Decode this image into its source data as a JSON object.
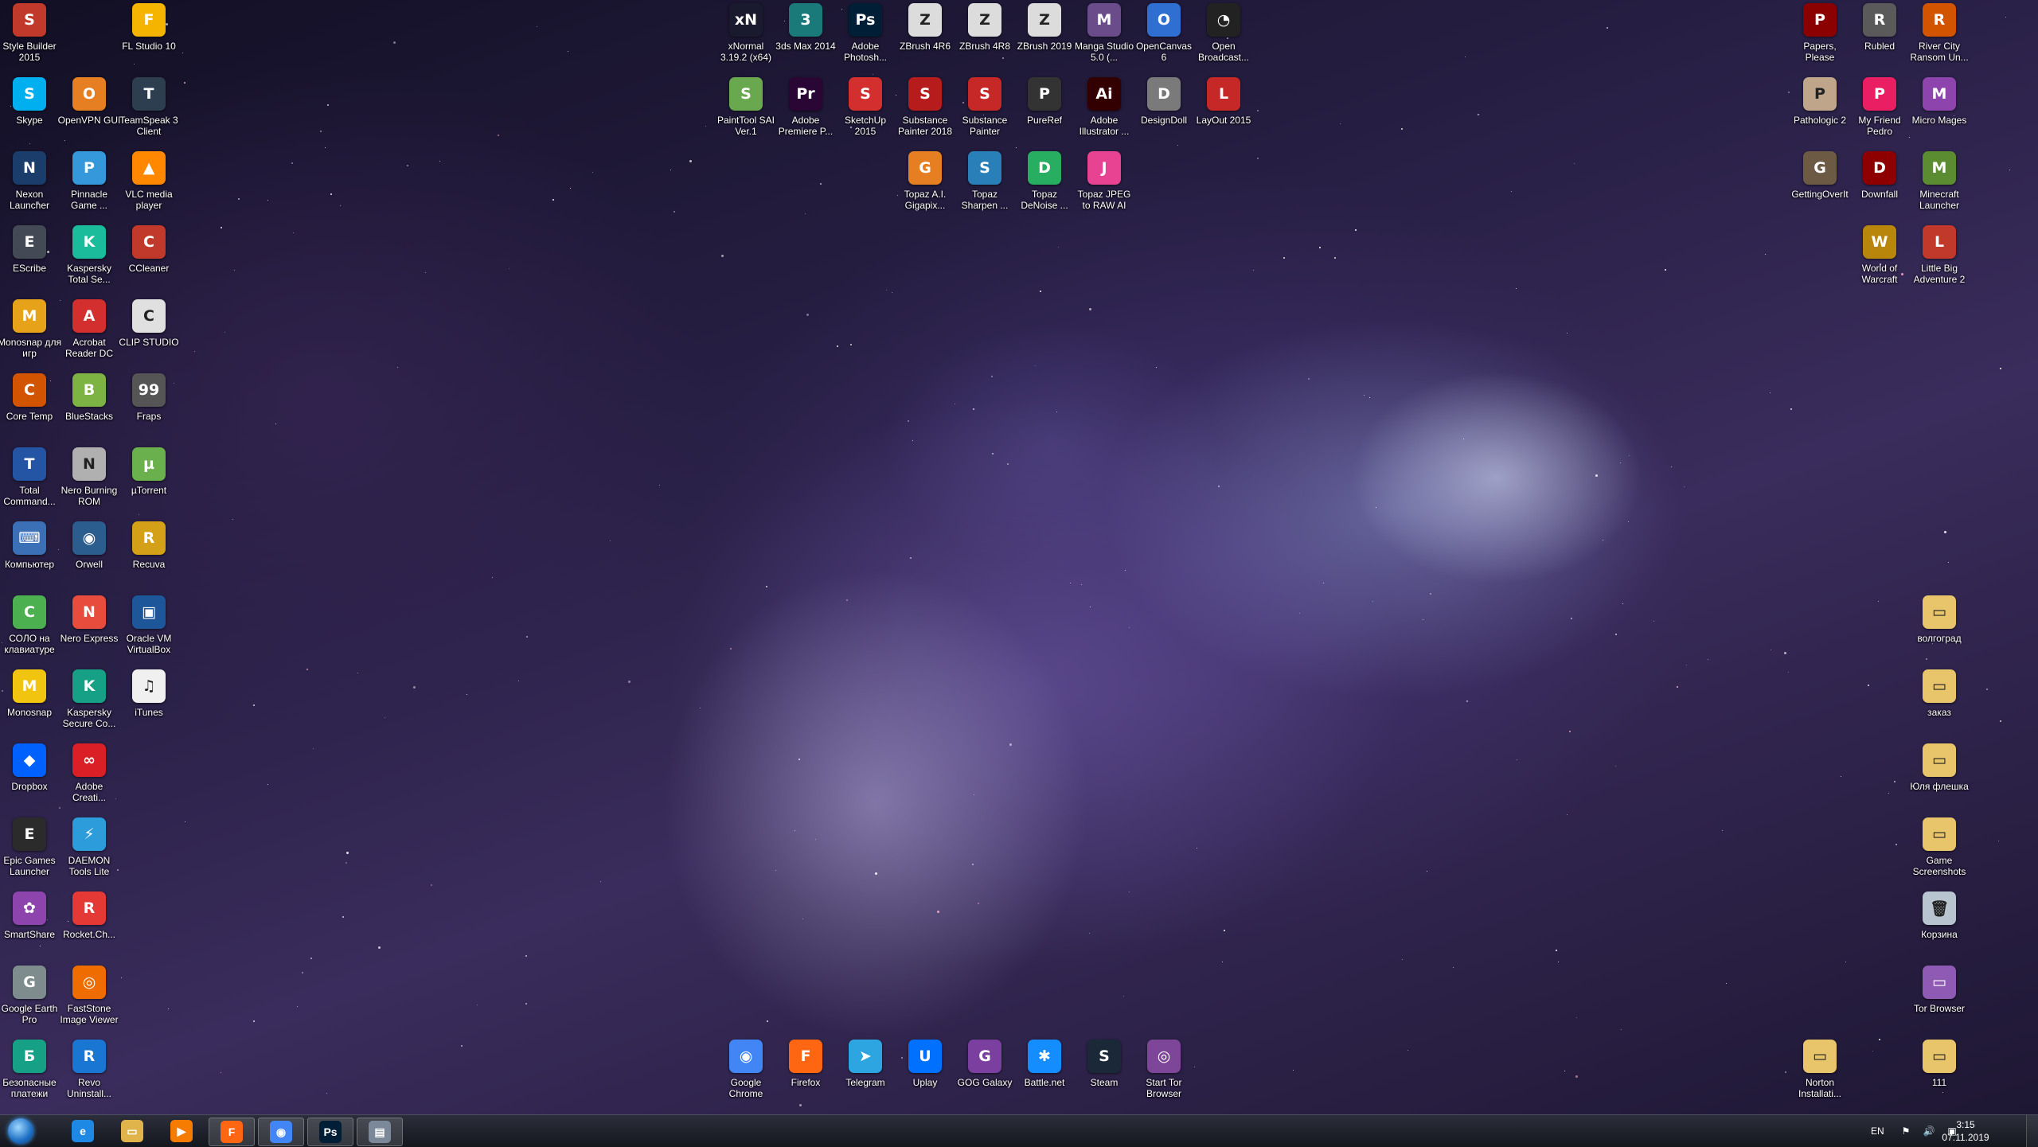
{
  "desktop": {
    "col1": [
      {
        "label": "Style Builder 2015",
        "icon": "style-builder-icon",
        "color": "#c0392b",
        "glyph": "S"
      },
      {
        "label": "Skype",
        "icon": "skype-icon",
        "color": "#00aff0",
        "glyph": "S"
      },
      {
        "label": "Nexon Launcher",
        "icon": "nexon-icon",
        "color": "#1b3d6b",
        "glyph": "N"
      },
      {
        "label": "EScribe",
        "icon": "escribe-icon",
        "color": "#444a55",
        "glyph": "E"
      },
      {
        "label": "Monosnap для игр",
        "icon": "monosnap-games-icon",
        "color": "#e6a31a",
        "glyph": "M"
      },
      {
        "label": "Core Temp",
        "icon": "core-temp-icon",
        "color": "#d35400",
        "glyph": "C"
      },
      {
        "label": "Total Command...",
        "icon": "total-commander-icon",
        "color": "#2455a4",
        "glyph": "T"
      },
      {
        "label": "Компьютер",
        "icon": "computer-icon",
        "color": "#3b6fb6",
        "glyph": "⌨"
      },
      {
        "label": "СОЛО на клавиатуре",
        "icon": "solo-keyboard-icon",
        "color": "#4caf50",
        "glyph": "С"
      },
      {
        "label": "Monosnap",
        "icon": "monosnap-icon",
        "color": "#f1c40f",
        "glyph": "M"
      },
      {
        "label": "Dropbox",
        "icon": "dropbox-icon",
        "color": "#0061fe",
        "glyph": "◆"
      },
      {
        "label": "Epic Games Launcher",
        "icon": "epic-games-icon",
        "color": "#2b2b2b",
        "glyph": "E"
      },
      {
        "label": "SmartShare",
        "icon": "smartshare-icon",
        "color": "#8e44ad",
        "glyph": "✿"
      },
      {
        "label": "Google Earth Pro",
        "icon": "google-earth-icon",
        "color": "#7f8c8d",
        "glyph": "G"
      },
      {
        "label": "Безопасные платежи",
        "icon": "safe-payments-icon",
        "color": "#16a085",
        "glyph": "Б"
      }
    ],
    "col2": [
      {
        "label": "OpenVPN GUI",
        "icon": "openvpn-icon",
        "color": "#e67e22",
        "glyph": "O"
      },
      {
        "label": "Pinnacle Game ...",
        "icon": "pinnacle-icon",
        "color": "#3498db",
        "glyph": "P"
      },
      {
        "label": "Kaspersky Total Se...",
        "icon": "kaspersky-total-icon",
        "color": "#1abc9c",
        "glyph": "K"
      },
      {
        "label": "Acrobat Reader DC",
        "icon": "acrobat-icon",
        "color": "#d32f2f",
        "glyph": "A"
      },
      {
        "label": "BlueStacks",
        "icon": "bluestacks-icon",
        "color": "#7cb342",
        "glyph": "B"
      },
      {
        "label": "Nero Burning ROM",
        "icon": "nero-burning-icon",
        "color": "#b0b0b0",
        "glyph": "N"
      },
      {
        "label": "Orwell",
        "icon": "orwell-icon",
        "color": "#2c5d8f",
        "glyph": "◉"
      },
      {
        "label": "Nero Express",
        "icon": "nero-express-icon",
        "color": "#e74c3c",
        "glyph": "N"
      },
      {
        "label": "Kaspersky Secure Co...",
        "icon": "kaspersky-secure-icon",
        "color": "#16a085",
        "glyph": "K"
      },
      {
        "label": "Adobe Creati...",
        "icon": "adobe-creative-icon",
        "color": "#da1f26",
        "glyph": "∞"
      },
      {
        "label": "DAEMON Tools Lite",
        "icon": "daemon-tools-icon",
        "color": "#2d9cdb",
        "glyph": "⚡"
      },
      {
        "label": "Rocket.Ch...",
        "icon": "rocket-chat-icon",
        "color": "#e53935",
        "glyph": "R"
      },
      {
        "label": "FastStone Image Viewer",
        "icon": "faststone-icon",
        "color": "#ef6c00",
        "glyph": "◎"
      },
      {
        "label": "Revo Uninstall...",
        "icon": "revo-uninstaller-icon",
        "color": "#1976d2",
        "glyph": "R"
      }
    ],
    "col3": [
      {
        "label": "FL Studio 10",
        "icon": "fl-studio-icon",
        "color": "#f4b400",
        "glyph": "F"
      },
      {
        "label": "TeamSpeak 3 Client",
        "icon": "teamspeak-icon",
        "color": "#2c3e50",
        "glyph": "T"
      },
      {
        "label": "VLC media player",
        "icon": "vlc-icon",
        "color": "#ff8800",
        "glyph": "▲"
      },
      {
        "label": "CCleaner",
        "icon": "ccleaner-icon",
        "color": "#c0392b",
        "glyph": "C"
      },
      {
        "label": "CLIP STUDIO",
        "icon": "clip-studio-icon",
        "color": "#e0e0e0",
        "glyph": "C"
      },
      {
        "label": "Fraps",
        "icon": "fraps-icon",
        "color": "#555555",
        "glyph": "99"
      },
      {
        "label": "µTorrent",
        "icon": "utorrent-icon",
        "color": "#6ab04c",
        "glyph": "µ"
      },
      {
        "label": "Recuva",
        "icon": "recuva-icon",
        "color": "#d4a017",
        "glyph": "R"
      },
      {
        "label": "Oracle VM VirtualBox",
        "icon": "virtualbox-icon",
        "color": "#1e5799",
        "glyph": "▣"
      },
      {
        "label": "iTunes",
        "icon": "itunes-icon",
        "color": "#f0f0f0",
        "glyph": "♫"
      }
    ],
    "top_row1": [
      {
        "label": "xNormal 3.19.2 (x64)",
        "icon": "xnormal-icon",
        "color": "#1a1a2e",
        "glyph": "xN"
      },
      {
        "label": "3ds Max 2014",
        "icon": "3dsmax-icon",
        "color": "#1a7a7a",
        "glyph": "3"
      },
      {
        "label": "Adobe Photosh...",
        "icon": "photoshop-icon",
        "color": "#001e36",
        "glyph": "Ps"
      },
      {
        "label": "ZBrush 4R6",
        "icon": "zbrush-4r6-icon",
        "color": "#dcdcdc",
        "glyph": "Z"
      },
      {
        "label": "ZBrush 4R8",
        "icon": "zbrush-4r8-icon",
        "color": "#dcdcdc",
        "glyph": "Z"
      },
      {
        "label": "ZBrush 2019",
        "icon": "zbrush-2019-icon",
        "color": "#dcdcdc",
        "glyph": "Z"
      },
      {
        "label": "Manga Studio 5.0 (...",
        "icon": "manga-studio-icon",
        "color": "#6b4c8a",
        "glyph": "M"
      },
      {
        "label": "OpenCanvas 6",
        "icon": "opencanvas-icon",
        "color": "#2f6fd1",
        "glyph": "O"
      },
      {
        "label": "Open Broadcast...",
        "icon": "obs-icon",
        "color": "#222222",
        "glyph": "◔"
      }
    ],
    "top_row2": [
      {
        "label": "PaintTool SAI Ver.1",
        "icon": "painttool-sai-icon",
        "color": "#6aa84f",
        "glyph": "S"
      },
      {
        "label": "Adobe Premiere P...",
        "icon": "premiere-icon",
        "color": "#2a0634",
        "glyph": "Pr"
      },
      {
        "label": "SketchUp 2015",
        "icon": "sketchup-icon",
        "color": "#d32f2f",
        "glyph": "S"
      },
      {
        "label": "Substance Painter 2018",
        "icon": "substance-2018-icon",
        "color": "#b71c1c",
        "glyph": "S"
      },
      {
        "label": "Substance Painter",
        "icon": "substance-icon",
        "color": "#c62828",
        "glyph": "S"
      },
      {
        "label": "PureRef",
        "icon": "pureref-icon",
        "color": "#333333",
        "glyph": "P"
      },
      {
        "label": "Adobe Illustrator ...",
        "icon": "illustrator-icon",
        "color": "#330000",
        "glyph": "Ai"
      },
      {
        "label": "DesignDoll",
        "icon": "designdoll-icon",
        "color": "#7a7a7a",
        "glyph": "D"
      },
      {
        "label": "LayOut 2015",
        "icon": "layout-icon",
        "color": "#c62828",
        "glyph": "L"
      }
    ],
    "top_row3": [
      {
        "label": "Topaz A.I. Gigapix...",
        "icon": "topaz-gigapixel-icon",
        "color": "#e67e22",
        "glyph": "G"
      },
      {
        "label": "Topaz Sharpen ...",
        "icon": "topaz-sharpen-icon",
        "color": "#2980b9",
        "glyph": "S"
      },
      {
        "label": "Topaz DeNoise ...",
        "icon": "topaz-denoise-icon",
        "color": "#27ae60",
        "glyph": "D"
      },
      {
        "label": "Topaz JPEG to RAW AI",
        "icon": "topaz-jpeg-icon",
        "color": "#e84393",
        "glyph": "J"
      }
    ],
    "bottom_row": [
      {
        "label": "Google Chrome",
        "icon": "chrome-icon",
        "color": "#4285f4",
        "glyph": "◉"
      },
      {
        "label": "Firefox",
        "icon": "firefox-icon",
        "color": "#ff6611",
        "glyph": "F"
      },
      {
        "label": "Telegram",
        "icon": "telegram-icon",
        "color": "#2ca5e0",
        "glyph": "➤"
      },
      {
        "label": "Uplay",
        "icon": "uplay-icon",
        "color": "#0070ff",
        "glyph": "U"
      },
      {
        "label": "GOG Galaxy",
        "icon": "gog-galaxy-icon",
        "color": "#7b3fa0",
        "glyph": "G"
      },
      {
        "label": "Battle.net",
        "icon": "battlenet-icon",
        "color": "#148eff",
        "glyph": "✱"
      },
      {
        "label": "Steam",
        "icon": "steam-icon",
        "color": "#1b2838",
        "glyph": "S"
      },
      {
        "label": "Start Tor Browser",
        "icon": "tor-browser-icon",
        "color": "#7d4698",
        "glyph": "◎"
      }
    ],
    "right_top1": [
      {
        "label": "Papers, Please",
        "icon": "papers-please-icon",
        "color": "#8b0000",
        "glyph": "P"
      },
      {
        "label": "Pathologic 2",
        "icon": "pathologic-icon",
        "color": "#bfa58a",
        "glyph": "P"
      },
      {
        "label": "GettingOverIt",
        "icon": "getting-over-it-icon",
        "color": "#6d5a45",
        "glyph": "G"
      }
    ],
    "right_top2": [
      {
        "label": "Rubled",
        "icon": "rubled-icon",
        "color": "#5a5a5a",
        "glyph": "R"
      },
      {
        "label": "My Friend Pedro",
        "icon": "my-friend-pedro-icon",
        "color": "#e91e63",
        "glyph": "P"
      },
      {
        "label": "Downfall",
        "icon": "downfall-icon",
        "color": "#8e0000",
        "glyph": "D"
      },
      {
        "label": "World of Warcraft",
        "icon": "wow-icon",
        "color": "#b8860b",
        "glyph": "W"
      }
    ],
    "right_top3": [
      {
        "label": "River City Ransom Un...",
        "icon": "river-city-icon",
        "color": "#d35400",
        "glyph": "R"
      },
      {
        "label": "Micro Mages",
        "icon": "micro-mages-icon",
        "color": "#8e44ad",
        "glyph": "M"
      },
      {
        "label": "Minecraft Launcher",
        "icon": "minecraft-icon",
        "color": "#5b8c32",
        "glyph": "M"
      },
      {
        "label": "Little Big Adventure 2",
        "icon": "lba2-icon",
        "color": "#c0392b",
        "glyph": "L"
      }
    ],
    "right_col_folders": [
      {
        "label": "волгоград",
        "icon": "folder-icon",
        "color": "#e8c56b",
        "glyph": "▭"
      },
      {
        "label": "заказ",
        "icon": "folder-icon",
        "color": "#e8c56b",
        "glyph": "▭"
      },
      {
        "label": "Юля флешка",
        "icon": "folder-icon",
        "color": "#e8c56b",
        "glyph": "▭"
      },
      {
        "label": "Game Screenshots",
        "icon": "folder-icon",
        "color": "#e8c56b",
        "glyph": "▭"
      },
      {
        "label": "Корзина",
        "icon": "recycle-bin-icon",
        "color": "#b8c4cf",
        "glyph": "🗑"
      },
      {
        "label": "Tor Browser",
        "icon": "folder-icon",
        "color": "#8e5ab3",
        "glyph": "▭"
      },
      {
        "label": "111",
        "icon": "folder-icon",
        "color": "#e8c56b",
        "glyph": "▭"
      }
    ],
    "norton": {
      "label": "Norton Installati...",
      "icon": "norton-folder-icon",
      "color": "#e8c56b",
      "glyph": "▭"
    }
  },
  "taskbar": {
    "start_label": "Start",
    "pinned": [
      {
        "name": "internet-explorer",
        "icon": "ie-icon",
        "color": "#1e88e5",
        "glyph": "e",
        "active": false
      },
      {
        "name": "explorer",
        "icon": "folder-icon",
        "color": "#e0b44a",
        "glyph": "▭",
        "active": false
      },
      {
        "name": "media-player",
        "icon": "media-player-icon",
        "color": "#f57c00",
        "glyph": "▶",
        "active": false
      },
      {
        "name": "firefox",
        "icon": "firefox-icon",
        "color": "#ff6611",
        "glyph": "F",
        "active": true
      },
      {
        "name": "chrome",
        "icon": "chrome-icon",
        "color": "#4285f4",
        "glyph": "◉",
        "active": true
      },
      {
        "name": "photoshop",
        "icon": "photoshop-icon",
        "color": "#001e36",
        "glyph": "Ps",
        "active": true
      },
      {
        "name": "document",
        "icon": "document-icon",
        "color": "#7a8899",
        "glyph": "▤",
        "active": true
      }
    ],
    "tray": {
      "language": "EN",
      "time": "3:15",
      "date": "07.11.2019"
    }
  }
}
